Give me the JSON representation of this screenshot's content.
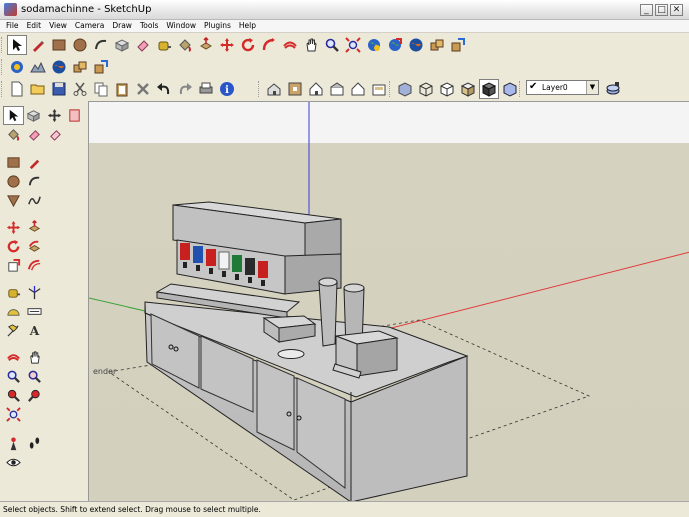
{
  "window": {
    "title": "sodamachinne - SketchUp",
    "minimize": "_",
    "maximize": "□",
    "close": "✕"
  },
  "menu": [
    "File",
    "Edit",
    "View",
    "Camera",
    "Draw",
    "Tools",
    "Window",
    "Plugins",
    "Help"
  ],
  "layers": {
    "current_layer": "Layer0",
    "check": "✔",
    "dropdown_arrow": "▼"
  },
  "viewport": {
    "partial_label": "endor"
  },
  "status": {
    "hint": "Select objects. Shift to extend select. Drag mouse to select multiple."
  },
  "colors": {
    "sky": "#f4f4f4",
    "ground": "#d5d1bf",
    "axis_red": "#e03a3a",
    "axis_green": "#3aa33a",
    "axis_blue": "#3a3ae0"
  }
}
